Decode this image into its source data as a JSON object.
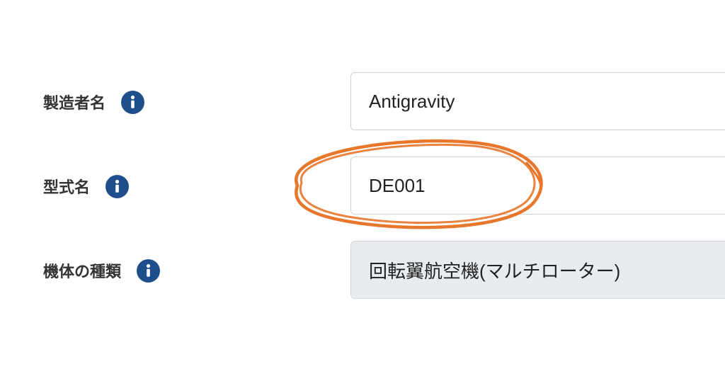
{
  "form": {
    "fields": [
      {
        "label": "製造者名",
        "info_icon": "info-icon",
        "value": "Antigravity",
        "state": "editable"
      },
      {
        "label": "型式名",
        "info_icon": "info-icon",
        "value": "DE001",
        "state": "editable",
        "highlighted": true
      },
      {
        "label": "機体の種類",
        "info_icon": "info-icon",
        "value": "回転翼航空機(マルチローター)",
        "state": "disabled"
      }
    ]
  },
  "colors": {
    "label_text": "#333333",
    "info_icon_bg": "#1f4e8c",
    "field_border": "#cfd4da",
    "disabled_bg": "#e9ecef",
    "highlight_stroke": "#e8762b"
  }
}
